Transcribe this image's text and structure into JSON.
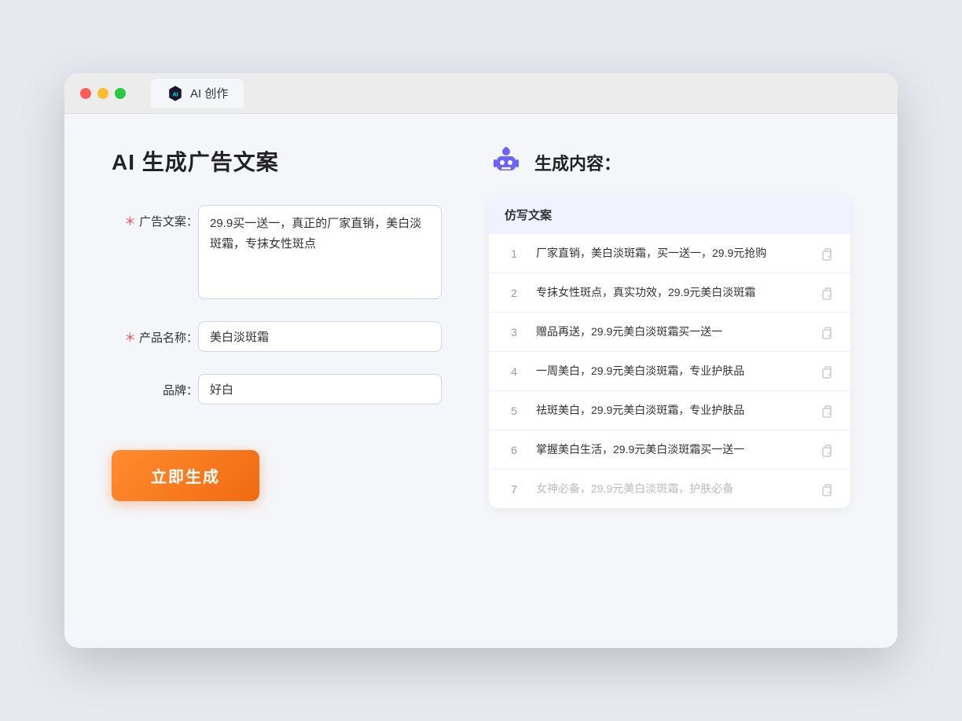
{
  "browser": {
    "tab_label": "AI 创作"
  },
  "page": {
    "title": "AI 生成广告文案"
  },
  "form": {
    "ad_copy_label": "广告文案：",
    "ad_copy_required": "＊",
    "ad_copy_value": "29.9买一送一，真正的厂家直销，美白淡斑霜，专抹女性斑点",
    "product_name_label": "产品名称：",
    "product_name_required": "＊",
    "product_name_value": "美白淡斑霜",
    "brand_label": "品牌：",
    "brand_value": "好白",
    "generate_btn": "立即生成"
  },
  "result": {
    "header_title": "生成内容：",
    "table_col_label": "仿写文案",
    "rows": [
      {
        "num": "1",
        "text": "厂家直销，美白淡斑霜，买一送一，29.9元抢购",
        "muted": false
      },
      {
        "num": "2",
        "text": "专抹女性斑点，真实功效，29.9元美白淡斑霜",
        "muted": false
      },
      {
        "num": "3",
        "text": "赠品再送，29.9元美白淡斑霜买一送一",
        "muted": false
      },
      {
        "num": "4",
        "text": "一周美白，29.9元美白淡斑霜，专业护肤品",
        "muted": false
      },
      {
        "num": "5",
        "text": "祛斑美白，29.9元美白淡斑霜，专业护肤品",
        "muted": false
      },
      {
        "num": "6",
        "text": "掌握美白生活，29.9元美白淡斑霜买一送一",
        "muted": false
      },
      {
        "num": "7",
        "text": "女神必备，29.9元美白淡斑霜，护肤必备",
        "muted": true
      }
    ]
  }
}
